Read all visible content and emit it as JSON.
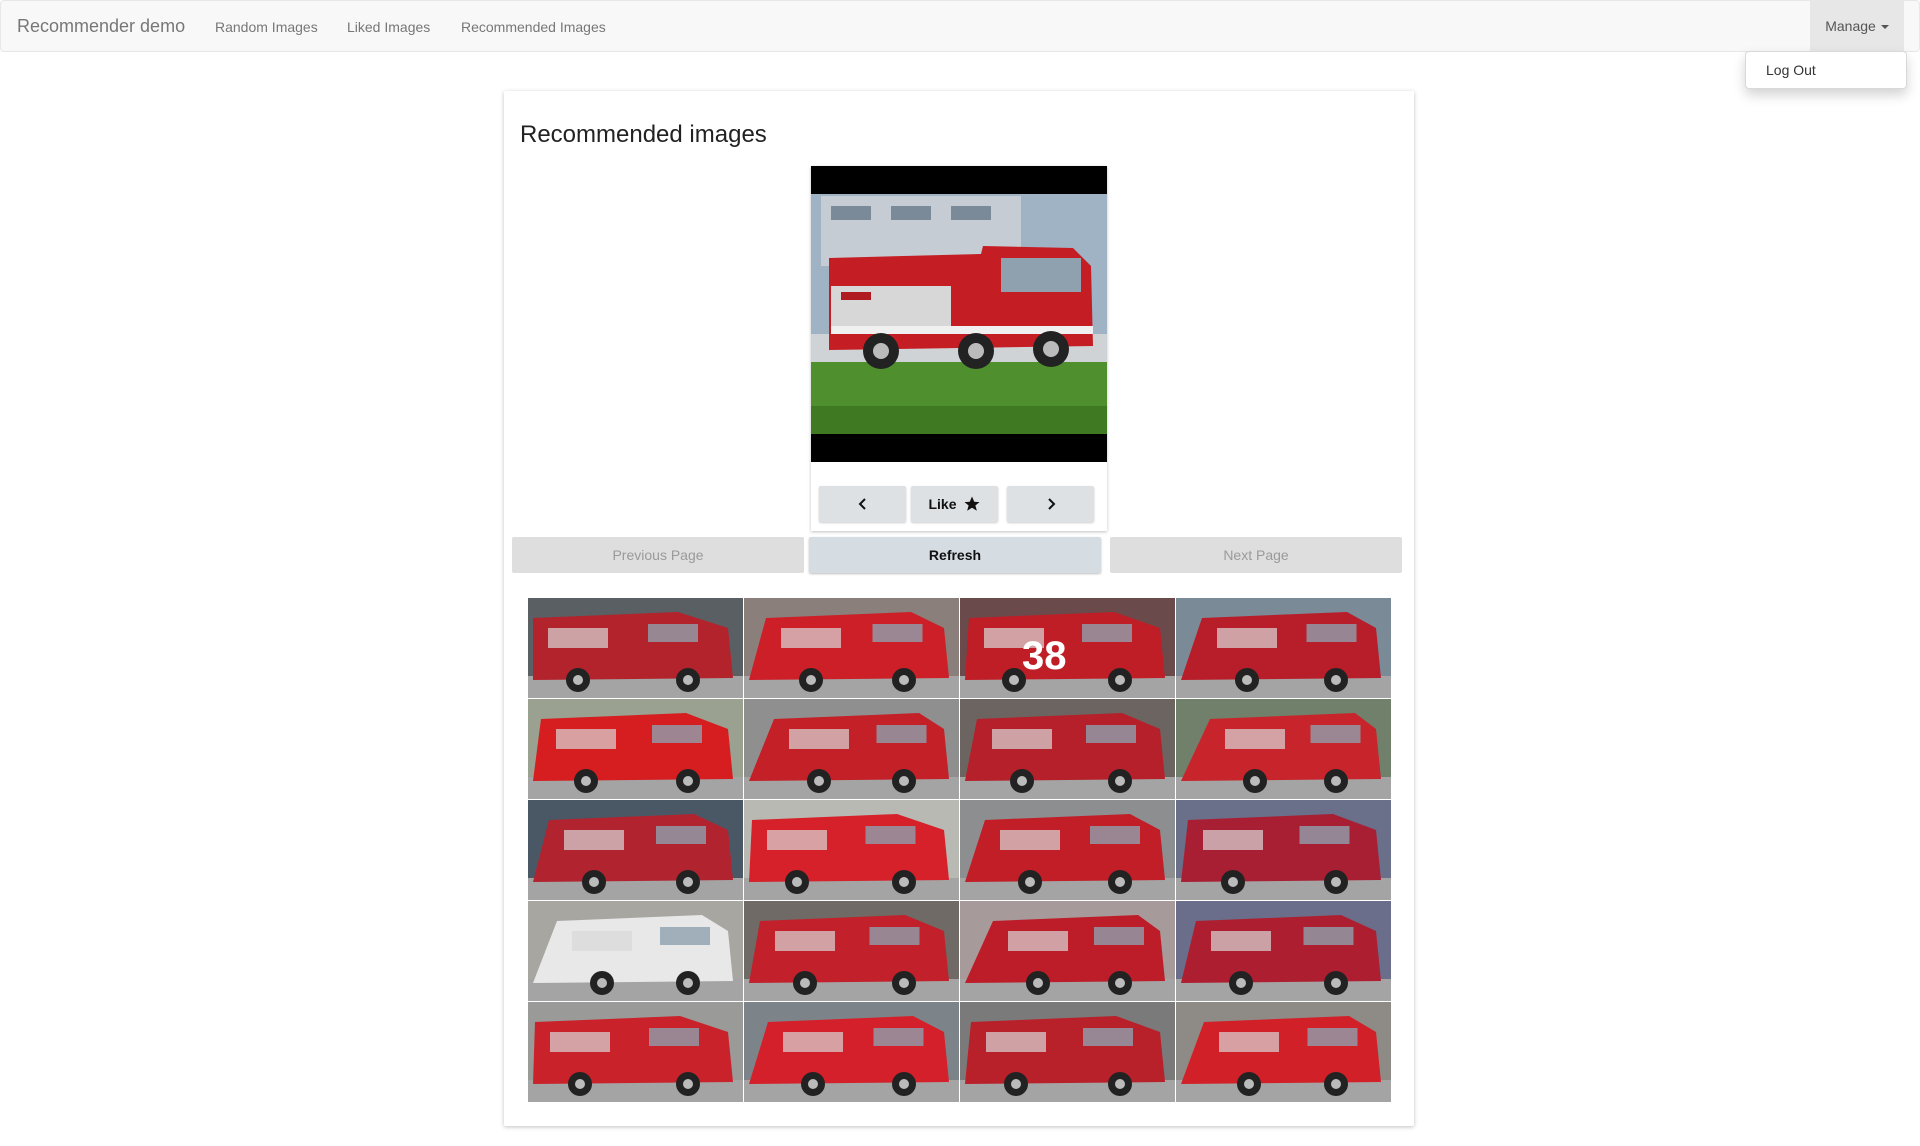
{
  "navbar": {
    "brand": "Recommender demo",
    "links": [
      "Random Images",
      "Liked Images",
      "Recommended Images"
    ],
    "manage_label": "Manage",
    "dropdown_items": [
      "Log Out"
    ]
  },
  "card": {
    "title": "Recommended images",
    "viewer": {
      "prev_icon": "chevron-left-icon",
      "like_label": "Like",
      "like_icon": "star-icon",
      "next_icon": "chevron-right-icon"
    },
    "pagination": {
      "previous_label": "Previous Page",
      "refresh_label": "Refresh",
      "next_label": "Next Page"
    },
    "thumbnails": [
      {
        "desc": "fire-truck",
        "bg": "#5a5f63",
        "body": "#b3232b"
      },
      {
        "desc": "fire-truck",
        "bg": "#8a7f7a",
        "body": "#cc1f28"
      },
      {
        "desc": "fire-truck",
        "bg": "#6b4a4c",
        "body": "#c01e26",
        "label": "38"
      },
      {
        "desc": "fire-truck",
        "bg": "#7a8a96",
        "body": "#b81d2a"
      },
      {
        "desc": "fire-truck",
        "bg": "#9aa190",
        "body": "#d61d20"
      },
      {
        "desc": "fire-truck",
        "bg": "#8f8f8f",
        "body": "#c42028"
      },
      {
        "desc": "fire-truck",
        "bg": "#6c6460",
        "body": "#b5202a"
      },
      {
        "desc": "fire-truck",
        "bg": "#70806a",
        "body": "#c8242b"
      },
      {
        "desc": "fire-truck",
        "bg": "#4a5866",
        "body": "#b22330"
      },
      {
        "desc": "fire-truck",
        "bg": "#b9b9b4",
        "body": "#d6202a"
      },
      {
        "desc": "fire-truck",
        "bg": "#8d8e90",
        "body": "#c11e27"
      },
      {
        "desc": "fire-truck",
        "bg": "#6a6f8a",
        "body": "#a81f33"
      },
      {
        "desc": "fire-truck",
        "bg": "#a8a6a1",
        "body": "#e8e8e8"
      },
      {
        "desc": "fire-truck",
        "bg": "#6f6a66",
        "body": "#c2202b"
      },
      {
        "desc": "fire-truck",
        "bg": "#a69a9a",
        "body": "#bd1d28"
      },
      {
        "desc": "fire-truck",
        "bg": "#6a6e8a",
        "body": "#ad1f30"
      },
      {
        "desc": "fire-truck",
        "bg": "#9a9a98",
        "body": "#c9222a"
      },
      {
        "desc": "fire-truck",
        "bg": "#7d8489",
        "body": "#d4202a"
      },
      {
        "desc": "fire-truck",
        "bg": "#7a7a7a",
        "body": "#b8202a"
      },
      {
        "desc": "fire-truck",
        "bg": "#8e8a86",
        "body": "#d22028"
      }
    ]
  }
}
